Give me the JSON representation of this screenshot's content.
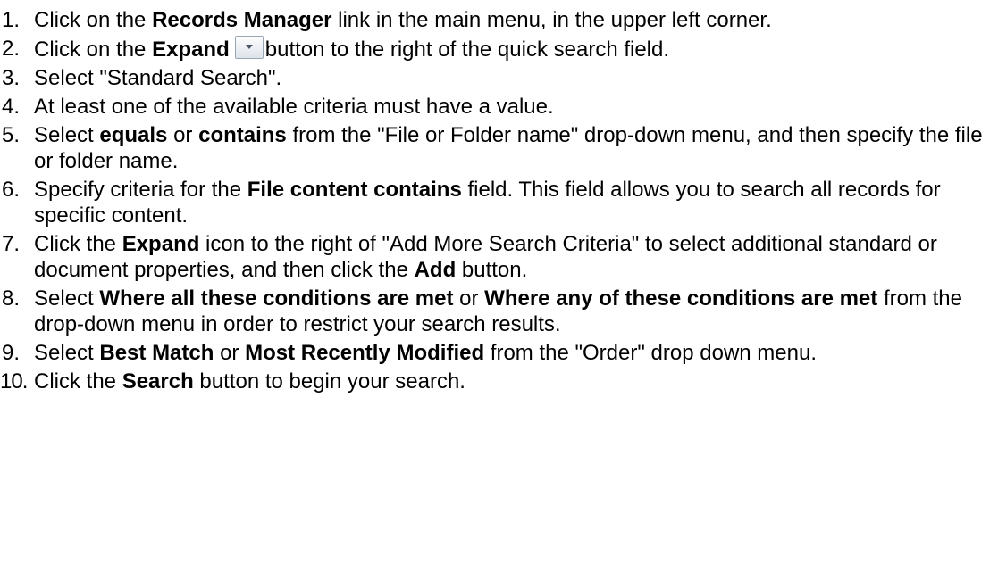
{
  "steps": [
    {
      "num": "1.",
      "t1": "Click on the ",
      "b1": "Records Manager",
      "t2": " link in the main menu, in the upper left corner."
    },
    {
      "num": "2.",
      "t1": "Click on the ",
      "b1": "Expand",
      "t2": "button to the right of the quick search field.",
      "icon": "expand-dropdown-icon"
    },
    {
      "num": "3.",
      "t1": "Select \"Standard Search\"."
    },
    {
      "num": "4.",
      "t1": "At least one of the available criteria must have a value."
    },
    {
      "num": "5.",
      "t1": "Select ",
      "b1": "equals",
      "t2": " or ",
      "b2": "contains",
      "t3": " from the \"File or Folder name\" drop-down menu, and then specify the file or folder name."
    },
    {
      "num": "6.",
      "t1": "Specify criteria for the ",
      "b1": "File content contains",
      "t2": " field. This field allows you to search all records for specific content."
    },
    {
      "num": "7.",
      "t1": "Click the ",
      "b1": "Expand",
      "t2": " icon to the right of \"Add More Search Criteria\" to select additional standard or document properties, and then click the ",
      "b2": "Add",
      "t3": " button."
    },
    {
      "num": "8.",
      "t1": "Select ",
      "b1": "Where all these conditions are met",
      "t2": " or ",
      "b2": "Where any of these conditions are met",
      "t3": " from the drop-down menu in order to restrict your search results."
    },
    {
      "num": "9.",
      "t1": "Select ",
      "b1": "Best Match",
      "t2": " or ",
      "b2": "Most Recently Modified",
      "t3": " from the \"Order\" drop down menu."
    },
    {
      "num": "10.",
      "t1": "Click the ",
      "b1": "Search",
      "t2": " button to begin your search."
    }
  ]
}
